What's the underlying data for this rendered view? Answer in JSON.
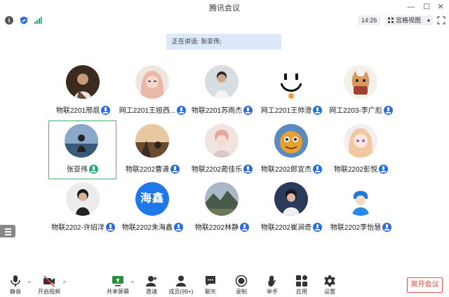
{
  "window": {
    "title": "腾讯会议"
  },
  "infobar": {
    "time": "14:26",
    "view_label": "宫格视图"
  },
  "speaking": "正在讲话: 张亚伟;",
  "participants": [
    {
      "name": "物联2201邢焜",
      "avatar": "photo"
    },
    {
      "name": "网工2201王娅西...",
      "avatar": "photo"
    },
    {
      "name": "物联2201苏雨杰",
      "avatar": "photo"
    },
    {
      "name": "网工2201王帅澄",
      "avatar": "photo"
    },
    {
      "name": "网工2203-李广彪",
      "avatar": "photo"
    },
    {
      "name": "张亚伟",
      "avatar": "photo",
      "speaking": true
    },
    {
      "name": "物联2202曹潇",
      "avatar": "photo"
    },
    {
      "name": "物联2202蔺佳乐",
      "avatar": "photo"
    },
    {
      "name": "物联2202郎宜杰",
      "avatar": "photo"
    },
    {
      "name": "物联2202彭悦",
      "avatar": "photo"
    },
    {
      "name": "物联2202-许绍洋",
      "avatar": "photo"
    },
    {
      "name": "物联2202朱海鑫",
      "avatar": "text",
      "avatar_text": "海鑫"
    },
    {
      "name": "物联2202林静",
      "avatar": "photo"
    },
    {
      "name": "物联2202崔涧奇",
      "avatar": "photo"
    },
    {
      "name": "物联2202李怡慧",
      "avatar": "photo"
    }
  ],
  "toolbar": {
    "mute": "静音",
    "video": "开启视频",
    "share": "共享屏幕",
    "invite": "邀请",
    "members": "成员(99+)",
    "chat": "聊天",
    "record": "录制",
    "raise": "举手",
    "apps": "应用",
    "settings": "设置",
    "leave": "离开会议"
  },
  "colors": {
    "accent": "#2a6fe0",
    "speaking_border": "#3cba6a",
    "leave": "#e04545",
    "toast_bg": "#dde9fb"
  }
}
